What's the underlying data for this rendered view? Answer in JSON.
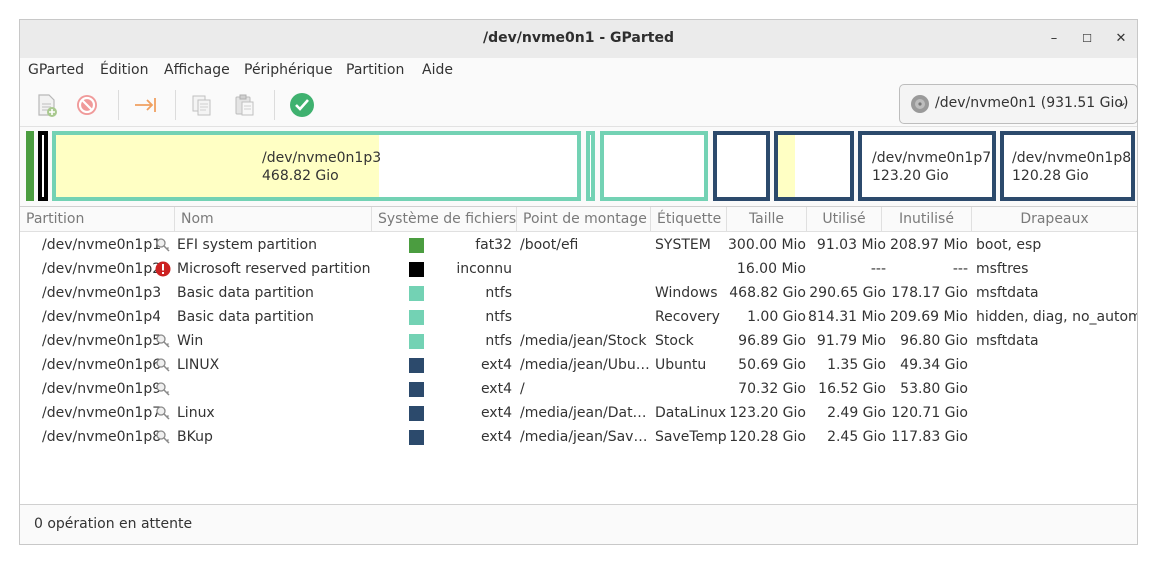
{
  "window": {
    "title": "/dev/nvme0n1 - GParted",
    "minimize": "–",
    "maximize": "☐",
    "close": "✕"
  },
  "menu": [
    "GParted",
    "Édition",
    "Affichage",
    "Périphérique",
    "Partition",
    "Aide"
  ],
  "device": {
    "label": "/dev/nvme0n1 (931.51 Gio)"
  },
  "map": [
    {
      "name": "",
      "size": "",
      "color": "#4b9d40",
      "used": 0
    },
    {
      "name": "",
      "size": "",
      "color": "#000000",
      "used": 0
    },
    {
      "name": "/dev/nvme0n1p3",
      "size": "468.82 Gio",
      "color": "#73d2b4",
      "used": 0.62
    },
    {
      "name": "",
      "size": "",
      "color": "#73d2b4",
      "used": 0
    },
    {
      "name": "",
      "size": "",
      "color": "#73d2b4",
      "used": 0
    },
    {
      "name": "",
      "size": "",
      "color": "#2c4a6c",
      "used": 0
    },
    {
      "name": "",
      "size": "",
      "color": "#2c4a6c",
      "used": 0.24
    },
    {
      "name": "/dev/nvme0n1p7",
      "size": "123.20 Gio",
      "color": "#2c4a6c",
      "used": 0
    },
    {
      "name": "/dev/nvme0n1p8",
      "size": "120.28 Gio",
      "color": "#2c4a6c",
      "used": 0
    }
  ],
  "columns": [
    "Partition",
    "Nom",
    "Système de fichiers",
    "Point de montage",
    "Étiquette",
    "Taille",
    "Utilisé",
    "Inutilisé",
    "Drapeaux"
  ],
  "rows": [
    {
      "partition": "/dev/nvme0n1p1",
      "icon": "key-icon",
      "name": "EFI system partition",
      "fs": "fat32",
      "color": "#4b9d40",
      "mount": "/boot/efi",
      "label": "SYSTEM",
      "size": "300.00 Mio",
      "used": "91.03 Mio",
      "unused": "208.97 Mio",
      "flags": "boot, esp"
    },
    {
      "partition": "/dev/nvme0n1p2",
      "icon": "warning-icon",
      "name": "Microsoft reserved partition",
      "fs": "inconnu",
      "color": "#000000",
      "mount": "",
      "label": "",
      "size": "16.00 Mio",
      "used": "---",
      "unused": "---",
      "flags": "msftres"
    },
    {
      "partition": "/dev/nvme0n1p3",
      "icon": "",
      "name": "Basic data partition",
      "fs": "ntfs",
      "color": "#73d2b4",
      "mount": "",
      "label": "Windows",
      "size": "468.82 Gio",
      "used": "290.65 Gio",
      "unused": "178.17 Gio",
      "flags": "msftdata"
    },
    {
      "partition": "/dev/nvme0n1p4",
      "icon": "",
      "name": "Basic data partition",
      "fs": "ntfs",
      "color": "#73d2b4",
      "mount": "",
      "label": "Recovery",
      "size": "1.00 Gio",
      "used": "814.31 Mio",
      "unused": "209.69 Mio",
      "flags": "hidden, diag, no_automount"
    },
    {
      "partition": "/dev/nvme0n1p5",
      "icon": "key-icon",
      "name": "Win",
      "fs": "ntfs",
      "color": "#73d2b4",
      "mount": "/media/jean/Stock",
      "label": "Stock",
      "size": "96.89 Gio",
      "used": "91.79 Mio",
      "unused": "96.80 Gio",
      "flags": "msftdata"
    },
    {
      "partition": "/dev/nvme0n1p6",
      "icon": "key-icon",
      "name": "LINUX",
      "fs": "ext4",
      "color": "#2c4a6c",
      "mount": "/media/jean/Ubu…",
      "label": "Ubuntu",
      "size": "50.69 Gio",
      "used": "1.35 Gio",
      "unused": "49.34 Gio",
      "flags": ""
    },
    {
      "partition": "/dev/nvme0n1p9",
      "icon": "key-icon",
      "name": "",
      "fs": "ext4",
      "color": "#2c4a6c",
      "mount": "/",
      "label": "",
      "size": "70.32 Gio",
      "used": "16.52 Gio",
      "unused": "53.80 Gio",
      "flags": ""
    },
    {
      "partition": "/dev/nvme0n1p7",
      "icon": "key-icon",
      "name": "Linux",
      "fs": "ext4",
      "color": "#2c4a6c",
      "mount": "/media/jean/Dat…",
      "label": "DataLinux",
      "size": "123.20 Gio",
      "used": "2.49 Gio",
      "unused": "120.71 Gio",
      "flags": ""
    },
    {
      "partition": "/dev/nvme0n1p8",
      "icon": "key-icon",
      "name": "BKup",
      "fs": "ext4",
      "color": "#2c4a6c",
      "mount": "/media/jean/Sav…",
      "label": "SaveTemp",
      "size": "120.28 Gio",
      "used": "2.45 Gio",
      "unused": "117.83 Gio",
      "flags": ""
    }
  ],
  "status": "0 opération en attente"
}
